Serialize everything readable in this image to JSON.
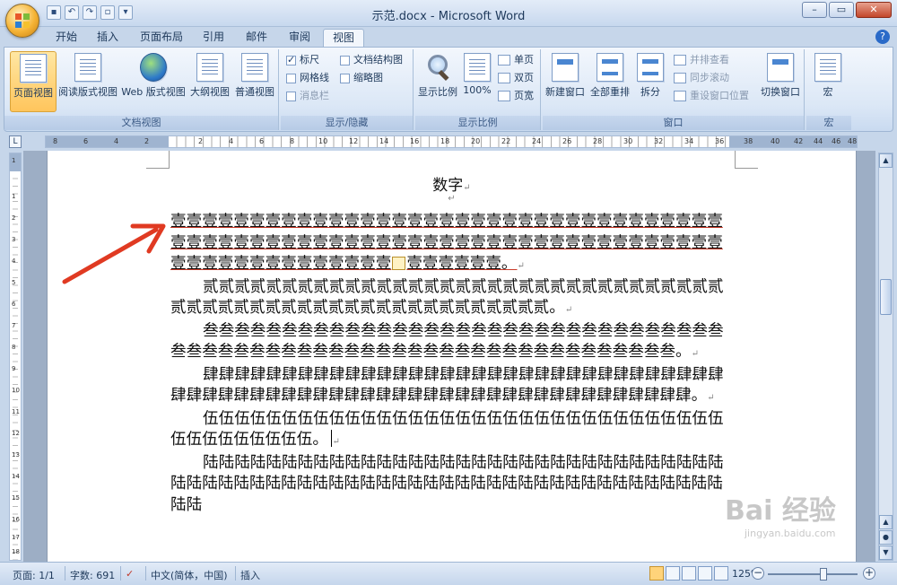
{
  "window": {
    "title": "示范.docx - Microsoft Word",
    "qat_icons": [
      "save-icon",
      "undo-icon",
      "redo-icon",
      "new-doc-icon",
      "customize-icon"
    ],
    "controls": [
      "minimize",
      "maximize",
      "close"
    ]
  },
  "tabs": [
    "开始",
    "插入",
    "页面布局",
    "引用",
    "邮件",
    "审阅",
    "视图"
  ],
  "active_tab": "视图",
  "ribbon": {
    "doc_views": {
      "group_name": "文档视图",
      "buttons": [
        "页面视图",
        "阅读版式视图",
        "Web 版式视图",
        "大纲视图",
        "普通视图"
      ]
    },
    "show_hide": {
      "group_name": "显示/隐藏",
      "ruler": "标尺",
      "gridlines": "网格线",
      "message_bar": "消息栏",
      "doc_map": "文档结构图",
      "thumbnails": "缩略图"
    },
    "zoom": {
      "group_name": "显示比例",
      "zoom_btn": "显示比例",
      "hundred_btn": "100%",
      "one_page": "单页",
      "two_pages": "双页",
      "page_width": "页宽"
    },
    "window": {
      "group_name": "窗口",
      "new_window": "新建窗口",
      "arrange_all": "全部重排",
      "split": "拆分",
      "side_by_side": "并排查看",
      "sync_scroll": "同步滚动",
      "reset_position": "重设窗口位置",
      "switch_windows": "切换窗口"
    },
    "macros": {
      "group_name": "宏",
      "macros_btn": "宏"
    }
  },
  "ruler": {
    "numbers": [
      "8",
      "6",
      "4",
      "2",
      "2",
      "4",
      "6",
      "8",
      "10",
      "12",
      "14",
      "16",
      "18",
      "20",
      "22",
      "24",
      "26",
      "28",
      "30",
      "32",
      "34",
      "36",
      "38",
      "40",
      "42",
      "44",
      "46",
      "48"
    ],
    "vertical_numbers": [
      "1",
      "1",
      "2",
      "3",
      "4",
      "5",
      "6",
      "7",
      "8",
      "9",
      "10",
      "11",
      "12",
      "13",
      "14",
      "15",
      "16",
      "17",
      "18"
    ]
  },
  "document": {
    "title": "数字",
    "p1_line1": "壹壹壹壹壹壹壹壹壹壹壹壹壹壹壹壹壹壹壹壹壹壹壹壹壹壹壹壹壹壹壹壹壹壹壹壹壹壹壹壹壹壹壹壹壹壹壹壹壹壹壹壹壹壹壹壹壹壹壹壹壹壹壹壹壹壹壹壹壹壹壹壹壹壹壹壹壹壹壹壹壹壹壹壹",
    "p1_line2": "壹壹壹",
    "p1_end": "壹壹壹。",
    "p2": "贰贰贰贰贰贰贰贰贰贰贰贰贰贰贰贰贰贰贰贰贰贰贰贰贰贰贰贰贰贰贰贰贰贰贰贰贰贰贰贰贰贰贰贰贰贰贰贰贰贰贰贰贰贰贰贰贰。",
    "p3": "叁叁叁叁叁叁叁叁叁叁叁叁叁叁叁叁叁叁叁叁叁叁叁叁叁叁叁叁叁叁叁叁叁叁叁叁叁叁叁叁叁叁叁叁叁叁叁叁叁叁叁叁叁叁叁叁叁叁叁叁叁叁叁叁叁。",
    "p4": "肆肆肆肆肆肆肆肆肆肆肆肆肆肆肆肆肆肆肆肆肆肆肆肆肆肆肆肆肆肆肆肆肆肆肆肆肆肆肆肆肆肆肆肆肆肆肆肆肆肆肆肆肆肆肆肆肆肆肆肆肆肆肆肆肆肆。",
    "p5": "伍伍伍伍伍伍伍伍伍伍伍伍伍伍伍伍伍伍伍伍伍伍伍伍伍伍伍伍伍伍伍伍伍伍伍伍伍伍伍伍伍伍。",
    "p6": "陆陆陆陆陆陆陆陆陆陆陆陆陆陆陆陆陆陆陆陆陆陆陆陆陆陆陆陆陆陆陆陆陆陆陆陆陆陆陆陆陆陆陆陆陆陆陆陆陆陆陆陆陆陆陆陆陆陆陆陆陆陆陆陆陆陆陆陆陆陆"
  },
  "annotation": {
    "arrow_color": "#e03a22"
  },
  "statusbar": {
    "page": "页面: 1/1",
    "words": "字数: 691",
    "language": "中文(简体，中国)",
    "mode": "插入",
    "zoom": "125%"
  },
  "watermark": {
    "brand": "Bai 经验",
    "url": "jingyan.baidu.com"
  }
}
